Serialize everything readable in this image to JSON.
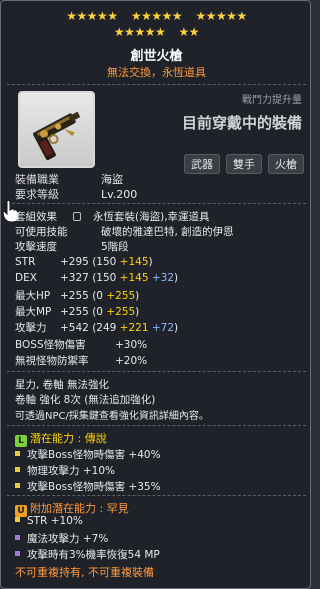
{
  "stars": {
    "row1": [
      "★★★★★",
      "★★★★★",
      "★★★★★"
    ],
    "row2": [
      "★★★★★",
      "★★"
    ]
  },
  "item": {
    "name": "創世火槍",
    "subtitle": "無法交換，永恆道具",
    "icon": "pistol-weapon-icon"
  },
  "header": {
    "power_label": "戰鬥力提升量",
    "equip_label": "目前穿戴中的裝備",
    "tags": [
      "武器",
      "雙手",
      "火槍"
    ]
  },
  "info": {
    "job_label": "裝備職業",
    "job_value": "海盜",
    "level_label": "要求等級",
    "level_value": "Lv.200"
  },
  "set": {
    "label": "套組效果",
    "value": "永恆套裝(海盜),幸運道具",
    "skill_label": "可使用技能",
    "skill_value": "破壞的雅達巴特, 創造的伊恩",
    "speed_label": "攻擊速度",
    "speed_value": "5階段"
  },
  "stats": [
    {
      "k": "STR",
      "total": "+295",
      "open": "(150",
      "p1": "+145",
      "p2": "",
      "close": ")"
    },
    {
      "k": "DEX",
      "total": "+327",
      "open": "(150",
      "p1": "+145",
      "p2": "+32",
      "close": ")"
    },
    {
      "k": "最大HP",
      "total": "+255",
      "open": "(0",
      "p1": "+255",
      "p2": "",
      "close": ")"
    },
    {
      "k": "最大MP",
      "total": "+255",
      "open": "(0",
      "p1": "+255",
      "p2": "",
      "close": ")"
    },
    {
      "k": "攻擊力",
      "total": "+542",
      "open": "(249",
      "p1": "+221",
      "p2": "+72",
      "close": ")"
    }
  ],
  "extra": {
    "boss_label": "BOSS怪物傷害",
    "boss_value": "+30%",
    "ignore_label": "無視怪物防禦率",
    "ignore_value": "+20%"
  },
  "star_enhance": {
    "line1": "星力, 卷軸 無法強化",
    "line2": "卷軸 強化 8次 (無法追加強化)",
    "line3": "可透過NPC/採集鍵查看強化資訊詳細內容。"
  },
  "potential": {
    "badge": "L",
    "label": "潛在能力 : 傳說",
    "lines": [
      "攻擊Boss怪物時傷害 +40%",
      "物理攻擊力 +10%",
      "攻擊Boss怪物時傷害 +35%"
    ]
  },
  "additional": {
    "badge": "U",
    "label": "附加潛在能力 : 罕見",
    "lines": [
      "STR +10%",
      "魔法攻擊力 +7%",
      "攻擊時有3%機率恢復54 MP"
    ]
  },
  "footer": "不可重複持有, 不可重複裝備"
}
